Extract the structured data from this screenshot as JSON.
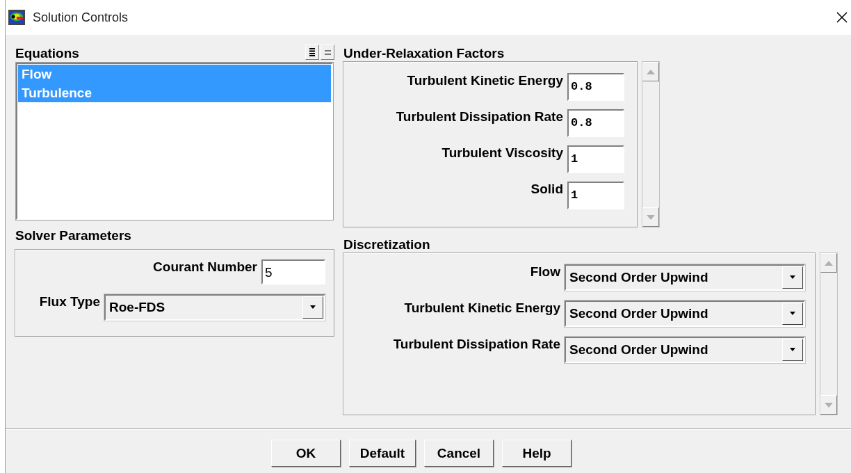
{
  "window": {
    "title": "Solution Controls"
  },
  "equations": {
    "label": "Equations",
    "items": [
      {
        "label": "Flow",
        "selected": true
      },
      {
        "label": "Turbulence",
        "selected": true
      }
    ]
  },
  "solver_parameters": {
    "label": "Solver Parameters",
    "courant_number": {
      "label": "Courant Number",
      "value": "5"
    },
    "flux_type": {
      "label": "Flux Type",
      "value": "Roe-FDS"
    }
  },
  "under_relaxation": {
    "label": "Under-Relaxation Factors",
    "fields": [
      {
        "label": "Turbulent Kinetic Energy",
        "value": "0.8"
      },
      {
        "label": "Turbulent Dissipation Rate",
        "value": "0.8"
      },
      {
        "label": "Turbulent Viscosity",
        "value": "1"
      },
      {
        "label": "Solid",
        "value": "1"
      }
    ]
  },
  "discretization": {
    "label": "Discretization",
    "rows": [
      {
        "label": "Flow",
        "value": "Second Order Upwind"
      },
      {
        "label": "Turbulent Kinetic Energy",
        "value": "Second Order Upwind"
      },
      {
        "label": "Turbulent Dissipation Rate",
        "value": "Second Order Upwind"
      }
    ]
  },
  "buttons": [
    "OK",
    "Default",
    "Cancel",
    "Help"
  ]
}
